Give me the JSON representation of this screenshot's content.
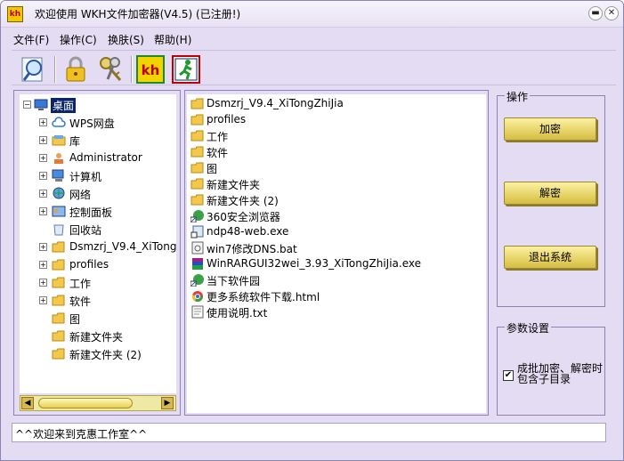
{
  "window": {
    "title": "欢迎使用 WKH文件加密器(V4.5)  (已注册!)",
    "app_icon_text": "kh",
    "minimize_label": "▬",
    "close_label": "✕"
  },
  "menu": {
    "items": [
      "文件(F)",
      "操作(C)",
      "换肤(S)",
      "帮助(H)"
    ]
  },
  "toolbar": {
    "buttons": [
      "search-icon",
      "lock-icon",
      "keys-icon",
      "kh-logo-icon",
      "exit-run-icon"
    ]
  },
  "tree": {
    "root": "桌面",
    "items": [
      {
        "label": "WPS网盘",
        "icon": "cloud-icon",
        "expandable": true
      },
      {
        "label": "库",
        "icon": "library-icon",
        "expandable": true
      },
      {
        "label": "Administrator",
        "icon": "user-icon",
        "expandable": true
      },
      {
        "label": "计算机",
        "icon": "computer-icon",
        "expandable": true
      },
      {
        "label": "网络",
        "icon": "network-icon",
        "expandable": true
      },
      {
        "label": "控制面板",
        "icon": "control-panel-icon",
        "expandable": true
      },
      {
        "label": "回收站",
        "icon": "recycle-bin-icon",
        "expandable": false
      },
      {
        "label": "Dsmzrj_V9.4_XiTong",
        "icon": "folder-icon",
        "expandable": true
      },
      {
        "label": "profiles",
        "icon": "folder-icon",
        "expandable": true
      },
      {
        "label": "工作",
        "icon": "folder-icon",
        "expandable": true
      },
      {
        "label": "软件",
        "icon": "folder-icon",
        "expandable": true
      },
      {
        "label": "图",
        "icon": "folder-icon",
        "expandable": false
      },
      {
        "label": "新建文件夹",
        "icon": "folder-icon",
        "expandable": false
      },
      {
        "label": "新建文件夹 (2)",
        "icon": "folder-icon",
        "expandable": false
      }
    ],
    "scroll_left": "◀",
    "scroll_right": "▶"
  },
  "files": {
    "items": [
      {
        "label": "Dsmzrj_V9.4_XiTongZhiJia",
        "icon": "folder-icon"
      },
      {
        "label": "profiles",
        "icon": "folder-icon"
      },
      {
        "label": "工作",
        "icon": "folder-icon"
      },
      {
        "label": "软件",
        "icon": "folder-icon"
      },
      {
        "label": "图",
        "icon": "folder-icon"
      },
      {
        "label": "新建文件夹",
        "icon": "folder-icon"
      },
      {
        "label": "新建文件夹 (2)",
        "icon": "folder-icon"
      },
      {
        "label": "360安全浏览器",
        "icon": "shortcut-icon"
      },
      {
        "label": "ndp48-web.exe",
        "icon": "installer-icon"
      },
      {
        "label": "win7修改DNS.bat",
        "icon": "batch-file-icon"
      },
      {
        "label": "WinRARGUI32wei_3.93_XiTongZhiJia.exe",
        "icon": "winrar-icon"
      },
      {
        "label": "当下软件园",
        "icon": "shortcut-icon"
      },
      {
        "label": "更多系统软件下载.html",
        "icon": "chrome-html-icon"
      },
      {
        "label": "使用说明.txt",
        "icon": "text-file-icon"
      }
    ]
  },
  "operations": {
    "title": "操作",
    "encrypt": "加密",
    "decrypt": "解密",
    "exit": "退出系统"
  },
  "params": {
    "title": "参数设置",
    "batch_label": "成批加密、解密时包含子目录",
    "batch_checked": true,
    "check_mark": "✔"
  },
  "status": {
    "text": "^^欢迎来到克惠工作室^^"
  },
  "colors": {
    "window_bg": "#e4dcf2",
    "button_gold": "#e6d266",
    "selection": "#0a246a",
    "folder": "#f2c94c"
  }
}
